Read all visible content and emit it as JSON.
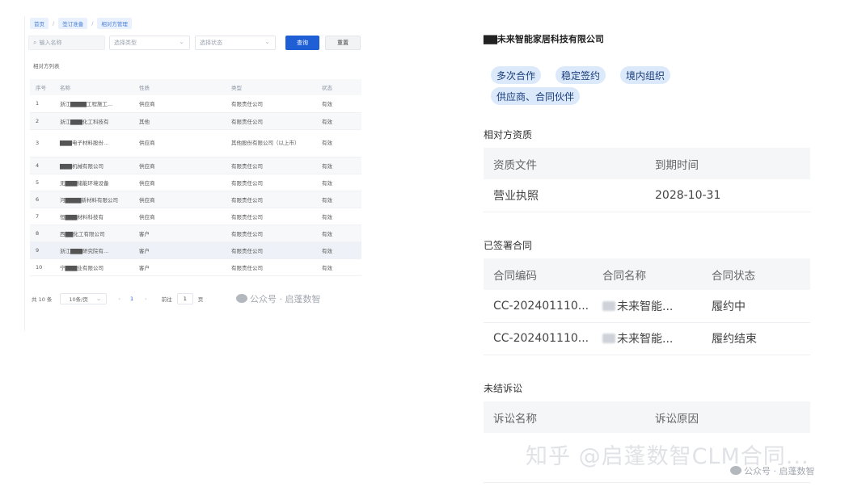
{
  "breadcrumb": [
    "首页",
    "签订准备",
    "相对方管理"
  ],
  "filters": {
    "search_placeholder": "输入名称",
    "type_placeholder": "选择类型",
    "status_placeholder": "选择状态",
    "query_label": "查询",
    "reset_label": "重置"
  },
  "list_title": "相对方列表",
  "table": {
    "headers": [
      "序号",
      "名称",
      "性质",
      "类型",
      "状态"
    ],
    "rows": [
      {
        "no": "1",
        "name": "浙江▇▇▇▇工程施工...",
        "nature": "供应商",
        "type": "有限责任公司",
        "status": "有效"
      },
      {
        "no": "2",
        "name": "浙江▇▇▇化工科技有",
        "nature": "其他",
        "type": "有限责任公司",
        "status": "有效"
      },
      {
        "no": "3",
        "name": "▇▇▇电子材料股份...",
        "nature": "供应商",
        "type": "其他股份有限公司（以上市）",
        "status": "有效"
      },
      {
        "no": "4",
        "name": "▇▇▇机械有限公司",
        "nature": "供应商",
        "type": "有限责任公司",
        "status": "有效"
      },
      {
        "no": "5",
        "name": "无▇▇▇储能环境设备",
        "nature": "供应商",
        "type": "有限责任公司",
        "status": "有效"
      },
      {
        "no": "6",
        "name": "河▇▇▇▇新材料有限公司",
        "nature": "供应商",
        "type": "有限责任公司",
        "status": "有效"
      },
      {
        "no": "7",
        "name": "恒▇▇▇材料科技有",
        "nature": "供应商",
        "type": "有限责任公司",
        "status": "有效"
      },
      {
        "no": "8",
        "name": "西▇▇化工有限公司",
        "nature": "客户",
        "type": "有限责任公司",
        "status": "有效"
      },
      {
        "no": "9",
        "name": "浙江▇▇▇研究院有...",
        "nature": "客户",
        "type": "有限责任公司",
        "status": "有效"
      },
      {
        "no": "10",
        "name": "宁▇▇▇业有限公司",
        "nature": "客户",
        "type": "有限责任公司",
        "status": "有效"
      }
    ]
  },
  "pagination": {
    "total": "共 10 条",
    "page_size": "10条/页",
    "prev": "‹",
    "current": "1",
    "next": "›",
    "goto_label": "前往",
    "goto_value": "1",
    "unit": "页"
  },
  "watermark_small": "公众号 · 启蓬数智",
  "detail": {
    "company_name": "▇▇未来智能家居科技有限公司",
    "tags": [
      "多次合作",
      "稳定签约",
      "境内组织",
      "供应商、合同伙伴"
    ],
    "qualification": {
      "title": "相对方资质",
      "headers": [
        "资质文件",
        "到期时间"
      ],
      "rows": [
        {
          "file": "营业执照",
          "expiry": "2028-10-31"
        }
      ]
    },
    "contracts": {
      "title": "已签署合同",
      "headers": [
        "合同编码",
        "合同名称",
        "合同状态"
      ],
      "rows": [
        {
          "code": "CC-202401110...",
          "name": "未来智能...",
          "status": "履约中"
        },
        {
          "code": "CC-202401110...",
          "name": "未来智能...",
          "status": "履约结束"
        }
      ]
    },
    "litigation": {
      "title": "未结诉讼",
      "headers": [
        "诉讼名称",
        "诉讼原因"
      ]
    }
  },
  "watermark_big": "知乎 @启蓬数智CLM合同...",
  "colors": {
    "primary": "#1f5fd6",
    "tag_bg": "#dbe9fb",
    "header_bg": "#f5f6f8"
  }
}
